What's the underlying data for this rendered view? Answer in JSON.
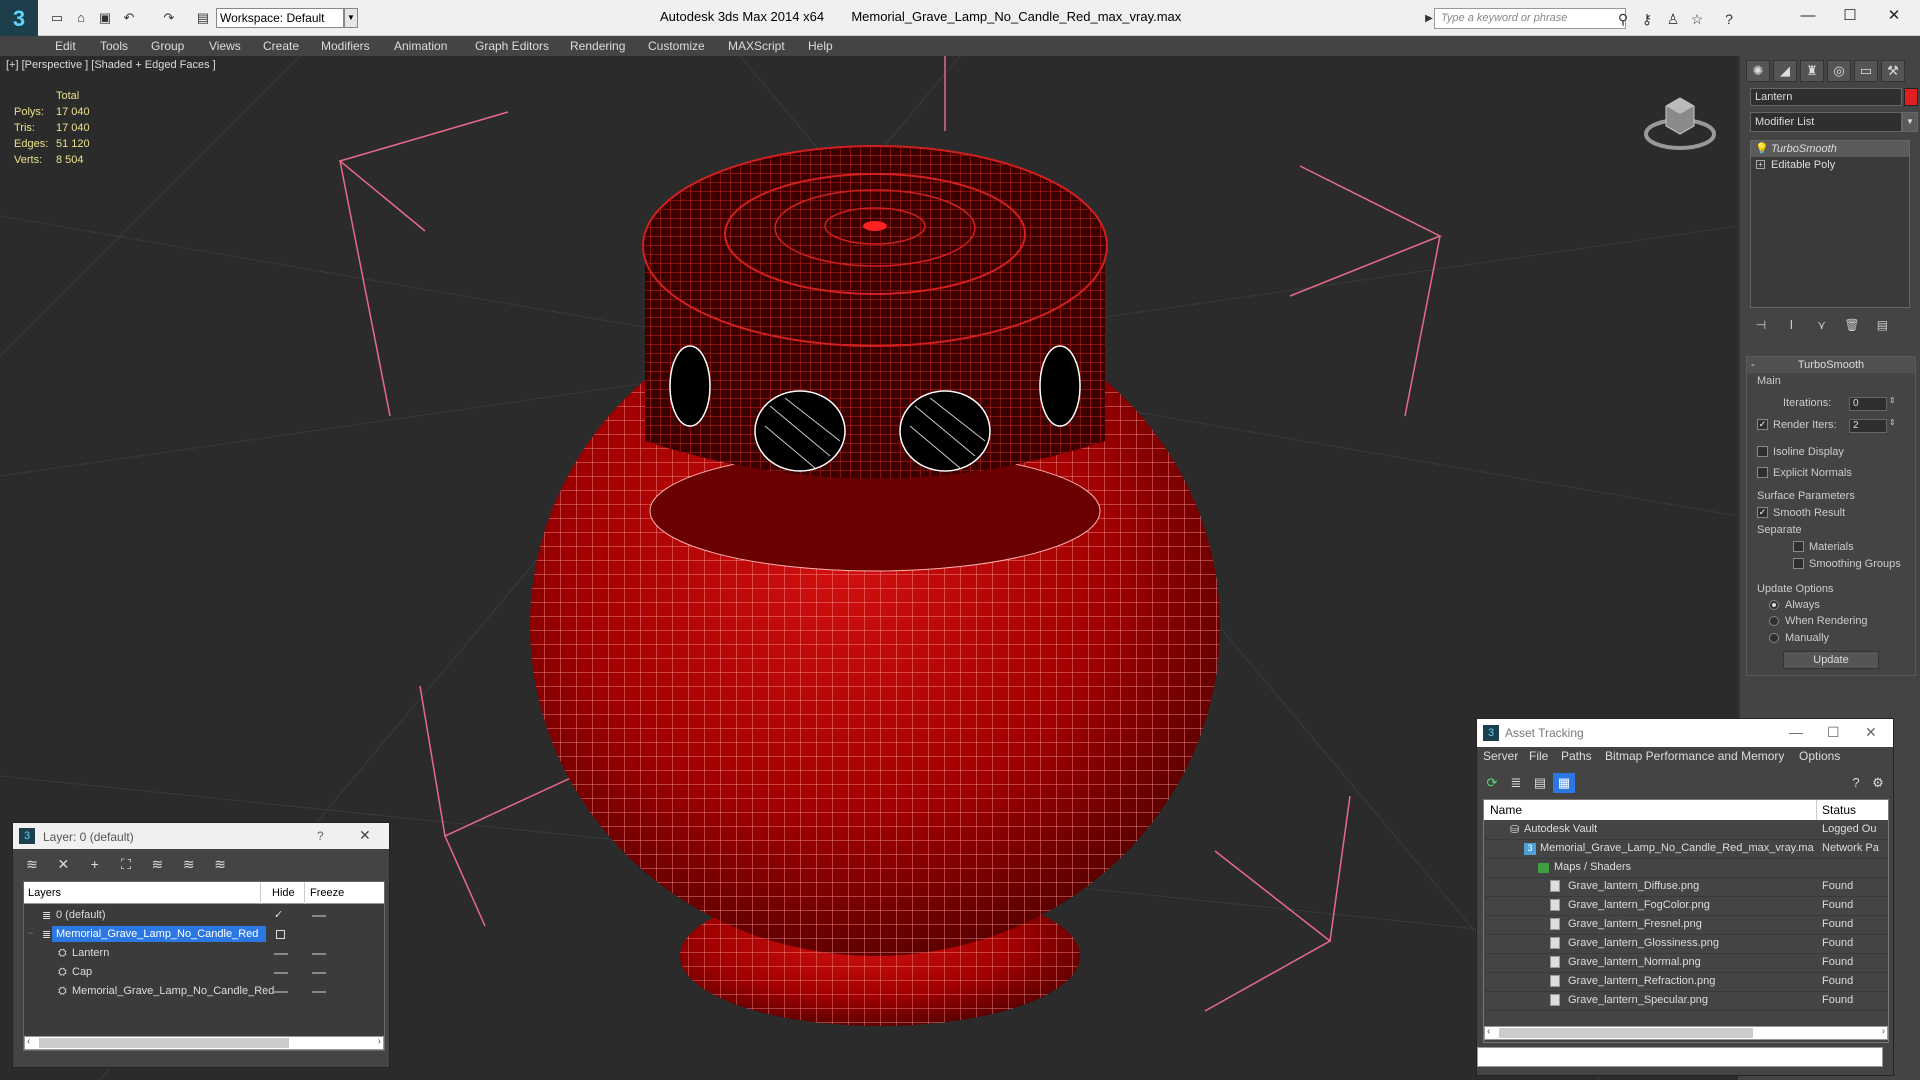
{
  "app": {
    "title": "Autodesk 3ds Max  2014 x64",
    "filename": "Memorial_Grave_Lamp_No_Candle_Red_max_vray.max",
    "workspace": "Workspace: Default",
    "search_placeholder": "Type a keyword or phrase",
    "logo": "3"
  },
  "menu": [
    "Edit",
    "Tools",
    "Group",
    "Views",
    "Create",
    "Modifiers",
    "Animation",
    "Graph Editors",
    "Rendering",
    "Customize",
    "MAXScript",
    "Help"
  ],
  "viewport": {
    "label": "[+] [Perspective ] [Shaded + Edged Faces ]",
    "stats": {
      "header": "Total",
      "rows": [
        {
          "k": "Polys:",
          "v": "17 040"
        },
        {
          "k": "Tris:",
          "v": "17 040"
        },
        {
          "k": "Edges:",
          "v": "51 120"
        },
        {
          "k": "Verts:",
          "v": "8 504"
        }
      ]
    },
    "object_color": "#b00000",
    "wire_color": "#ff4040"
  },
  "command_panel": {
    "object_name": "Lantern",
    "object_color": "#e02020",
    "modifier_list": "Modifier List",
    "stack": [
      "TurboSmooth",
      "Editable Poly"
    ],
    "rollout_title": "TurboSmooth",
    "main_label": "Main",
    "iterations_label": "Iterations:",
    "iterations_value": "0",
    "render_iters_label": "Render Iters:",
    "render_iters_value": "2",
    "isoline_label": "Isoline Display",
    "explicit_label": "Explicit Normals",
    "surface_label": "Surface Parameters",
    "smooth_label": "Smooth Result",
    "separate_label": "Separate",
    "materials_label": "Materials",
    "smoothing_label": "Smoothing Groups",
    "update_options_label": "Update Options",
    "always_label": "Always",
    "when_rendering_label": "When Rendering",
    "manually_label": "Manually",
    "update_button": "Update"
  },
  "layer_window": {
    "title": "Layer: 0 (default)",
    "help": "?",
    "col_layers": "Layers",
    "col_hide": "Hide",
    "col_freeze": "Freeze",
    "rows": [
      {
        "name": "0 (default)",
        "indent": 1
      },
      {
        "name": "Memorial_Grave_Lamp_No_Candle_Red",
        "indent": 1,
        "selected": true
      },
      {
        "name": "Lantern",
        "indent": 2
      },
      {
        "name": "Cap",
        "indent": 2
      },
      {
        "name": "Memorial_Grave_Lamp_No_Candle_Red",
        "indent": 2
      }
    ]
  },
  "asset_window": {
    "title": "Asset Tracking",
    "menu": [
      "Server",
      "File",
      "Paths",
      "Bitmap Performance and Memory",
      "Options"
    ],
    "col_name": "Name",
    "col_status": "Status",
    "rows": [
      {
        "name": "Autodesk Vault",
        "status": "Logged Ou",
        "indent": 1
      },
      {
        "name": "Memorial_Grave_Lamp_No_Candle_Red_max_vray.max",
        "status": "Network Pa",
        "indent": 2
      },
      {
        "name": "Maps / Shaders",
        "status": "",
        "indent": 3
      },
      {
        "name": "Grave_lantern_Diffuse.png",
        "status": "Found",
        "indent": 4
      },
      {
        "name": "Grave_lantern_FogColor.png",
        "status": "Found",
        "indent": 4
      },
      {
        "name": "Grave_lantern_Fresnel.png",
        "status": "Found",
        "indent": 4
      },
      {
        "name": "Grave_lantern_Glossiness.png",
        "status": "Found",
        "indent": 4
      },
      {
        "name": "Grave_lantern_Normal.png",
        "status": "Found",
        "indent": 4
      },
      {
        "name": "Grave_lantern_Refraction.png",
        "status": "Found",
        "indent": 4
      },
      {
        "name": "Grave_lantern_Specular.png",
        "status": "Found",
        "indent": 4
      }
    ]
  }
}
